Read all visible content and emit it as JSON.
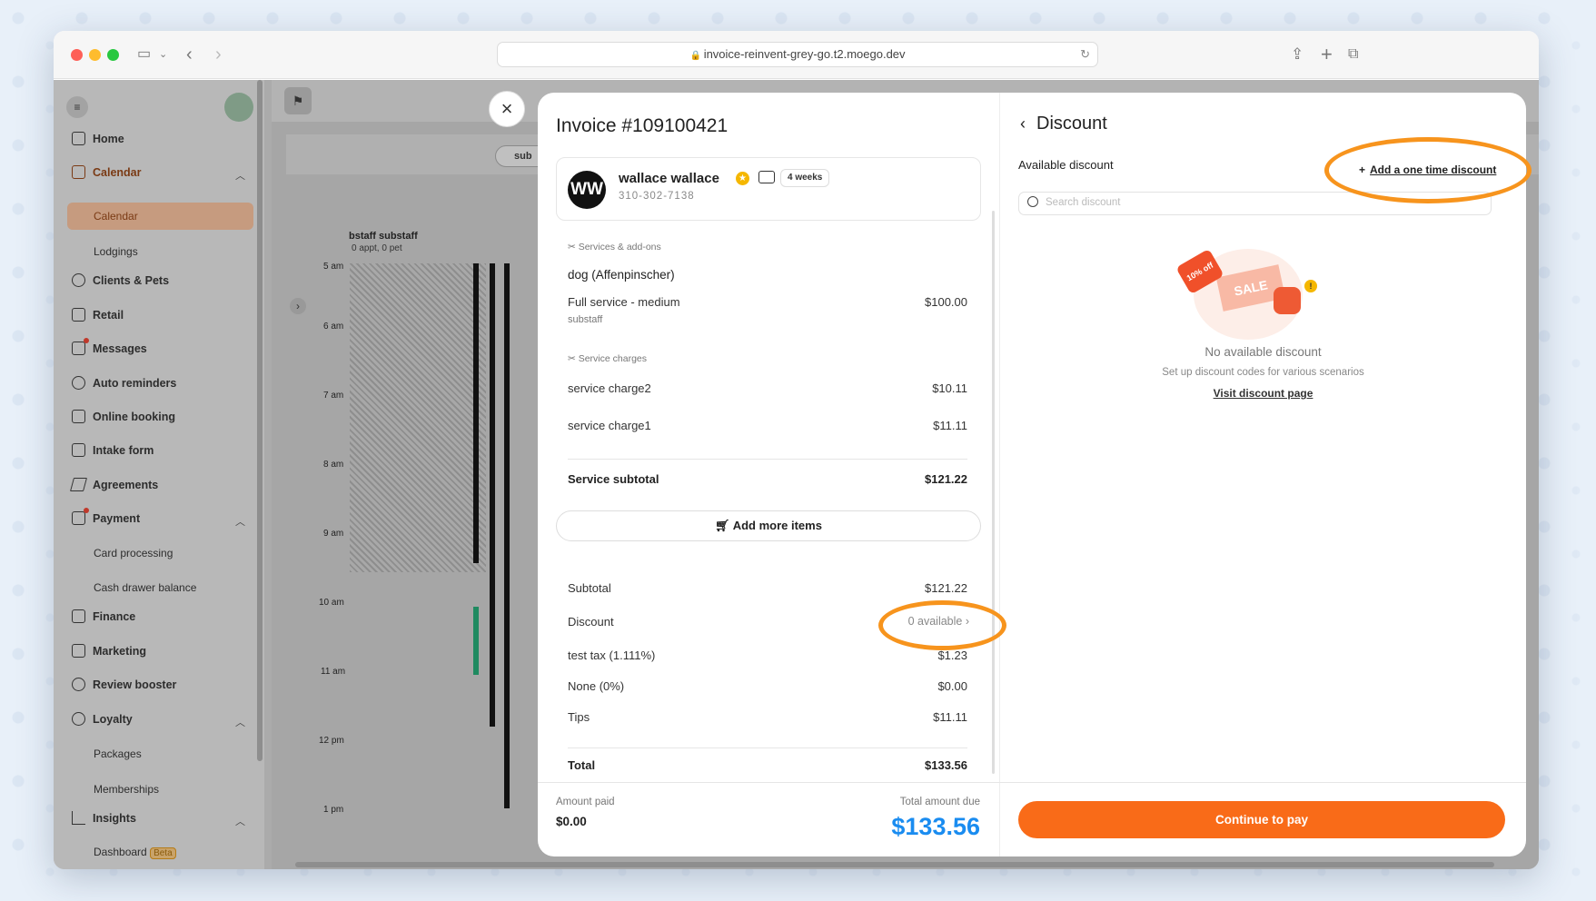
{
  "browser": {
    "url": "invoice-reinvent-grey-go.t2.moego.dev"
  },
  "sidebar": {
    "items": [
      {
        "label": "Home"
      },
      {
        "label": "Calendar"
      },
      {
        "label": "Clients & Pets"
      },
      {
        "label": "Retail"
      },
      {
        "label": "Messages"
      },
      {
        "label": "Auto reminders"
      },
      {
        "label": "Online booking"
      },
      {
        "label": "Intake form"
      },
      {
        "label": "Agreements"
      },
      {
        "label": "Payment"
      },
      {
        "label": "Finance"
      },
      {
        "label": "Marketing"
      },
      {
        "label": "Review booster"
      },
      {
        "label": "Loyalty"
      },
      {
        "label": "Insights"
      }
    ],
    "subitems": {
      "calendar": "Calendar",
      "lodgings": "Lodgings",
      "card": "Card processing",
      "cash": "Cash drawer balance",
      "packages": "Packages",
      "memberships": "Memberships",
      "dashboard": "Dashboard"
    },
    "beta": "Beta"
  },
  "calendar": {
    "staff": "bstaff substaff",
    "staff_sub": "0 appt, 0 pet",
    "times": [
      "5 am",
      "6 am",
      "7 am",
      "8 am",
      "9 am",
      "10 am",
      "11 am",
      "12 pm",
      "1 pm"
    ],
    "tab": "sub"
  },
  "invoice": {
    "title": "Invoice #109100421",
    "client": {
      "initials": "WW",
      "name": "wallace wallace",
      "phone": "310-302-7138",
      "freq": "4 weeks"
    },
    "services_header": "Services & add-ons",
    "pet": "dog (Affenpinscher)",
    "service": {
      "name": "Full service - medium",
      "staff": "substaff",
      "price": "$100.00"
    },
    "charges_header": "Service charges",
    "charges": [
      {
        "name": "service charge2",
        "price": "$10.11"
      },
      {
        "name": "service charge1",
        "price": "$11.11"
      }
    ],
    "service_subtotal": {
      "label": "Service subtotal",
      "value": "$121.22"
    },
    "add_more": "Add more items",
    "summary": [
      {
        "label": "Subtotal",
        "value": "$121.22"
      },
      {
        "label": "Discount",
        "value": "0 available"
      },
      {
        "label": "test tax (1.111%)",
        "value": "$1.23"
      },
      {
        "label": "None (0%)",
        "value": "$0.00"
      },
      {
        "label": "Tips",
        "value": "$11.11"
      }
    ],
    "total": {
      "label": "Total",
      "value": "$133.56"
    },
    "amount_paid_label": "Amount paid",
    "amount_paid": "$0.00",
    "due_label": "Total amount due",
    "due": "$133.56"
  },
  "discount": {
    "title": "Discount",
    "available_label": "Available discount",
    "add_one_time": "Add a one time discount",
    "search_placeholder": "Search discount",
    "empty_title": "No available discount",
    "empty_sub": "Set up discount codes for various scenarios",
    "visit": "Visit discount page",
    "continue": "Continue to pay",
    "badge": "10% off",
    "sale": "SALE"
  },
  "colors": {
    "accent": "#f96b18",
    "due": "#1a8cf0",
    "highlight": "#f7941d"
  }
}
